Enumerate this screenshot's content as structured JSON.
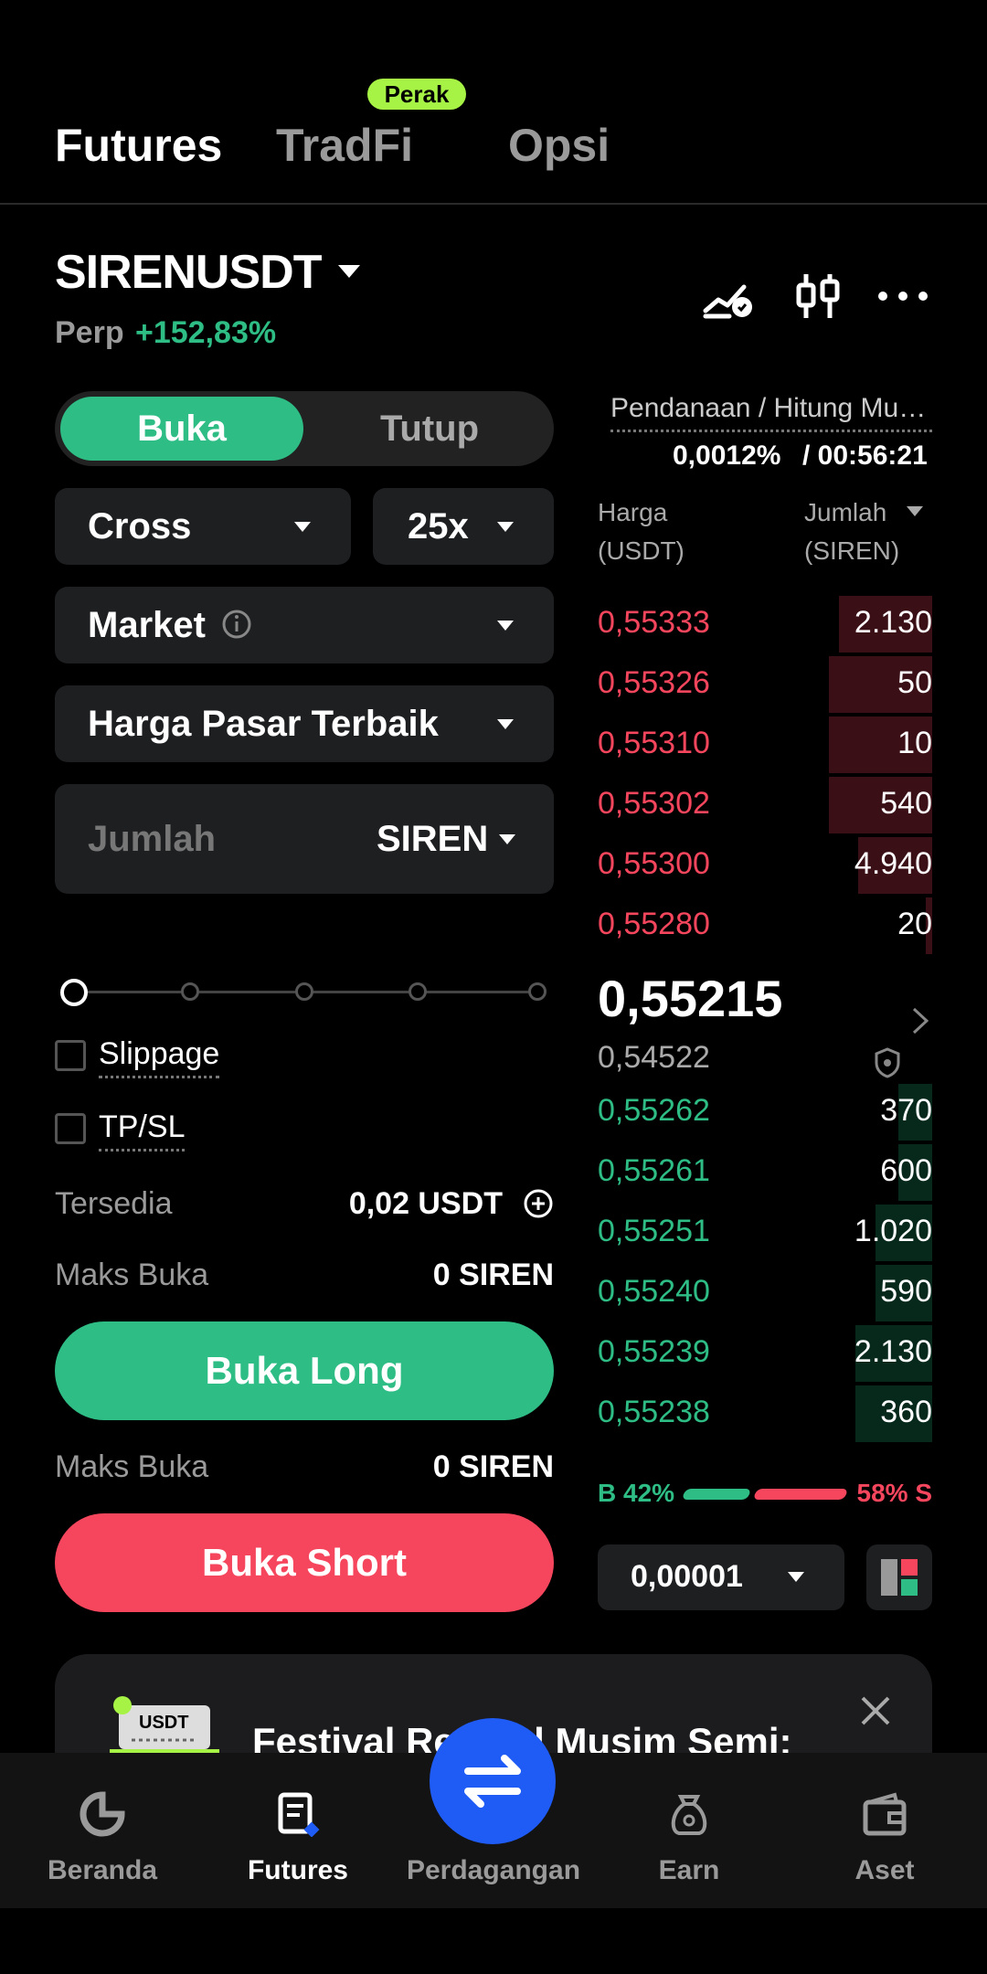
{
  "top_tabs": {
    "futures": "Futures",
    "tradfi": "TradFi",
    "opsi": "Opsi",
    "tradfi_badge": "Perak"
  },
  "symbol": {
    "name": "SIRENUSDT",
    "type": "Perp",
    "change": "+152,83%"
  },
  "order_form": {
    "open": "Buka",
    "close": "Tutup",
    "margin_mode": "Cross",
    "leverage": "25x",
    "order_type": "Market",
    "price_type": "Harga Pasar Terbaik",
    "amount_placeholder": "Jumlah",
    "amount_unit": "SIREN",
    "slippage": "Slippage",
    "tpsl": "TP/SL",
    "available_label": "Tersedia",
    "available_value": "0,02 USDT",
    "max_open_label": "Maks Buka",
    "max_open_long": "0 SIREN",
    "max_open_short": "0 SIREN",
    "long_button": "Buka Long",
    "short_button": "Buka Short"
  },
  "orderbook": {
    "funding_title": "Pendanaan / Hitung Mun...",
    "funding_rate": "0,0012%",
    "countdown": "/ 00:56:21",
    "price_header_1": "Harga",
    "price_header_2": "(USDT)",
    "amount_header_1": "Jumlah",
    "amount_header_2": "(SIREN)",
    "asks": [
      {
        "price": "0,55333",
        "amount": "2.130",
        "depth": 0.28
      },
      {
        "price": "0,55326",
        "amount": "50",
        "depth": 0.31
      },
      {
        "price": "0,55310",
        "amount": "10",
        "depth": 0.31
      },
      {
        "price": "0,55302",
        "amount": "540",
        "depth": 0.31
      },
      {
        "price": "0,55300",
        "amount": "4.940",
        "depth": 0.22
      },
      {
        "price": "0,55280",
        "amount": "20",
        "depth": 0.02
      }
    ],
    "last_price": "0,55215",
    "mark_price": "0,54522",
    "bids": [
      {
        "price": "0,55262",
        "amount": "370",
        "depth": 0.1
      },
      {
        "price": "0,55261",
        "amount": "600",
        "depth": 0.1
      },
      {
        "price": "0,55251",
        "amount": "1.020",
        "depth": 0.17
      },
      {
        "price": "0,55240",
        "amount": "590",
        "depth": 0.17
      },
      {
        "price": "0,55239",
        "amount": "2.130",
        "depth": 0.23
      },
      {
        "price": "0,55238",
        "amount": "360",
        "depth": 0.23
      }
    ],
    "buy_ratio": "B 42%",
    "sell_ratio": "58% S",
    "tick_size": "0,00001"
  },
  "promo": {
    "title": "Festival Reward Musim Semi:",
    "ticket_label": "USDT"
  },
  "bottom_nav": {
    "home": "Beranda",
    "futures": "Futures",
    "trade": "Perdagangan",
    "earn": "Earn",
    "assets": "Aset"
  },
  "colors": {
    "green": "#2ebd85",
    "red": "#f6465d",
    "blue": "#1f5bf5",
    "badge": "#a6f346"
  }
}
